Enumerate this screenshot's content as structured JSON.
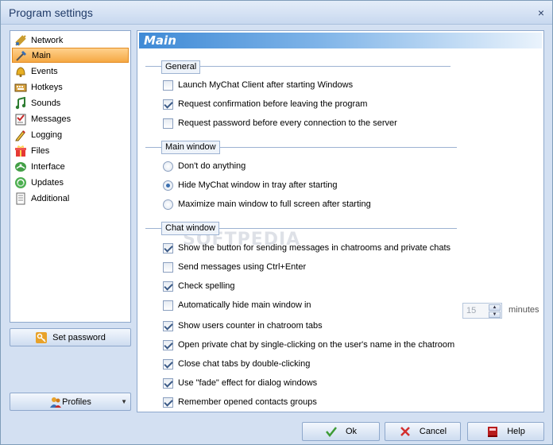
{
  "window": {
    "title": "Program settings",
    "close_glyph": "×"
  },
  "nav": {
    "items": [
      {
        "label": "Network",
        "icon": "network-icon",
        "selected": false
      },
      {
        "label": "Main",
        "icon": "main-icon",
        "selected": true
      },
      {
        "label": "Events",
        "icon": "events-icon",
        "selected": false
      },
      {
        "label": "Hotkeys",
        "icon": "hotkeys-icon",
        "selected": false
      },
      {
        "label": "Sounds",
        "icon": "sounds-icon",
        "selected": false
      },
      {
        "label": "Messages",
        "icon": "messages-icon",
        "selected": false
      },
      {
        "label": "Logging",
        "icon": "logging-icon",
        "selected": false
      },
      {
        "label": "Files",
        "icon": "files-icon",
        "selected": false
      },
      {
        "label": "Interface",
        "icon": "interface-icon",
        "selected": false
      },
      {
        "label": "Updates",
        "icon": "updates-icon",
        "selected": false
      },
      {
        "label": "Additional",
        "icon": "additional-icon",
        "selected": false
      }
    ],
    "set_password_label": "Set password",
    "profiles_label": "Profiles"
  },
  "panel": {
    "title": "Main",
    "groups": {
      "general": {
        "label": "General",
        "options": [
          {
            "label": "Launch MyChat Client after starting Windows",
            "checked": false
          },
          {
            "label": "Request confirmation before leaving the program",
            "checked": true
          },
          {
            "label": "Request password before every connection to the server",
            "checked": false
          }
        ]
      },
      "main_window": {
        "label": "Main window",
        "options": [
          {
            "label": "Don't do anything",
            "selected": false
          },
          {
            "label": "Hide MyChat window in tray after starting",
            "selected": true
          },
          {
            "label": "Maximize main window to full screen after starting",
            "selected": false
          }
        ]
      },
      "chat_window": {
        "label": "Chat window",
        "options": [
          {
            "label": "Show the button for sending messages in chatrooms and private chats",
            "checked": true
          },
          {
            "label": "Send messages using Ctrl+Enter",
            "checked": false
          },
          {
            "label": "Check spelling",
            "checked": true
          },
          {
            "label": "Automatically hide main window in",
            "checked": false
          },
          {
            "label": "Show users counter in chatroom tabs",
            "checked": true
          },
          {
            "label": "Open private chat by single-clicking on the user's name in the chatroom",
            "checked": true
          },
          {
            "label": "Close chat tabs by double-clicking",
            "checked": true
          },
          {
            "label": "Use \"fade\" effect for dialog windows",
            "checked": true
          },
          {
            "label": "Remember opened contacts groups",
            "checked": true
          }
        ],
        "autohide_value": "15",
        "autohide_unit": "minutes"
      }
    },
    "watermark": "SOFTPEDIA"
  },
  "buttons": {
    "ok": "Ok",
    "cancel": "Cancel",
    "help": "Help"
  },
  "colors": {
    "accent": "#3f8ad6",
    "selection": "#f5a843",
    "window_bg": "#d3e0f2"
  }
}
